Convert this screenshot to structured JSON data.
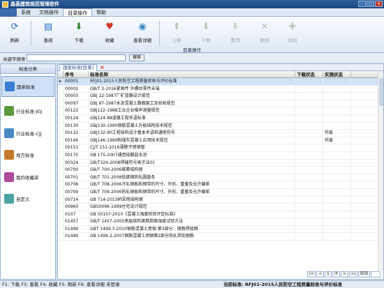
{
  "app": {
    "title": "晶荟建筑规范管理软件"
  },
  "menu": {
    "items": [
      "系统",
      "文档操作",
      "目录操作",
      "帮助"
    ],
    "active_index": 2
  },
  "ribbon": {
    "buttons": [
      {
        "label": "刷新",
        "icon": "refresh-icon",
        "enabled": true
      },
      {
        "label": "查阅",
        "icon": "document-view-icon",
        "enabled": true
      },
      {
        "label": "下载",
        "icon": "download-icon",
        "enabled": true
      },
      {
        "label": "收藏",
        "icon": "heart-icon",
        "enabled": true
      },
      {
        "label": "查看详细",
        "icon": "details-icon",
        "enabled": true
      },
      {
        "label": "上移",
        "icon": "arrow-up-icon",
        "enabled": false
      },
      {
        "label": "下移",
        "icon": "arrow-down-icon",
        "enabled": false
      },
      {
        "label": "置顶",
        "icon": "arrow-top-icon",
        "enabled": false
      },
      {
        "label": "移除",
        "icon": "remove-icon",
        "enabled": false
      },
      {
        "label": "添加",
        "icon": "add-icon",
        "enabled": false
      }
    ],
    "group_label": "目录操作"
  },
  "search": {
    "label": "关键字搜索",
    "value": "",
    "button": "搜索"
  },
  "sidebar": {
    "header": "标准分类",
    "items": [
      {
        "label": "国家标准",
        "active": true,
        "color": "#3b7fd4"
      },
      {
        "label": "行业标准-JGJ",
        "active": false,
        "color": "#5a9a3a"
      },
      {
        "label": "行业标准-CJJ",
        "active": false,
        "color": "#4a8ac4"
      },
      {
        "label": "地方标准",
        "active": false,
        "color": "#c47a2a"
      },
      {
        "label": "我的收藏夹",
        "active": false,
        "color": "#b04a9a"
      },
      {
        "label": "自定义",
        "active": false,
        "color": "#4aa4a4"
      }
    ]
  },
  "tab": {
    "label": "国家标准[目录]"
  },
  "grid": {
    "headers": [
      "序号",
      "标准名称",
      "下载状态",
      "实施状态"
    ],
    "rows": [
      {
        "no": "00001",
        "name": "RFJ01-2015人民防空工程质量验收与评价标准",
        "dl": "",
        "st": "",
        "sel": true
      },
      {
        "no": "00002",
        "name": "GB/T 2-2016紧固件 外螺纹零件末端",
        "dl": "",
        "st": ""
      },
      {
        "no": "00003",
        "name": "GBJ 22-1987厂矿道路设计规范",
        "dl": "",
        "st": ""
      },
      {
        "no": "00097",
        "name": "GBJ 97-1987水泥混凝土路面施工及验收规范",
        "dl": "",
        "st": ""
      },
      {
        "no": "00122",
        "name": "GBJ122-1988工业企业噪声测量规范",
        "dl": "",
        "st": ""
      },
      {
        "no": "00124",
        "name": "GBJ124-88道路工程术语标准",
        "dl": "",
        "st": ""
      },
      {
        "no": "00130",
        "name": "GBJ130-1990钢筋混凝土升板结构技术规范",
        "dl": "",
        "st": ""
      },
      {
        "no": "00132",
        "name": "GBJ132-90工程结构设计基本术语和通用符号",
        "dl": "",
        "st": "作废"
      },
      {
        "no": "00146",
        "name": "GBJ146-1990粉煤灰混凝土应用技术规范",
        "dl": "",
        "st": "作废"
      },
      {
        "no": "00151",
        "name": "CJ/T 151-2016薄壁不锈钢管",
        "dl": "",
        "st": ""
      },
      {
        "no": "00175",
        "name": "GB 175-2007通用硅酸盐水泥",
        "dl": "",
        "st": ""
      },
      {
        "no": "00324",
        "name": "GB/T324-2008焊缝符号表示法01",
        "dl": "",
        "st": ""
      },
      {
        "no": "00700",
        "name": "GB/T 700-2006碳素结构钢",
        "dl": "",
        "st": ""
      },
      {
        "no": "00701",
        "name": "GB/T 701-2008低碳钢热轧圆盘条",
        "dl": "",
        "st": ""
      },
      {
        "no": "00708",
        "name": "GB/T 708-2006冷轧钢板和钢带的尺寸、外形、重量及允许偏差",
        "dl": "",
        "st": ""
      },
      {
        "no": "00709",
        "name": "GB/T 709-2006热轧钢板和钢带的尺寸、外形、重量及允许偏差",
        "dl": "",
        "st": ""
      },
      {
        "no": "00714",
        "name": "GB 714-2015桥梁用结构钢",
        "dl": "",
        "st": ""
      },
      {
        "no": "00960",
        "name": "GB50096-1999住宅设计规范",
        "dl": "",
        "st": ""
      },
      {
        "no": "0107",
        "name": "GB 50107-2010《混凝土强度检验评定标准》",
        "dl": "",
        "st": ""
      },
      {
        "no": "01457",
        "name": "GB/T 1457-2005夹层结构滚筒剥离强度试验方法",
        "dl": "",
        "st": ""
      },
      {
        "no": "01499",
        "name": "GBT 1499.3-2010钢筋混凝土用钢 第3部分：钢筋焊接网",
        "dl": "",
        "st": ""
      },
      {
        "no": "01499",
        "name": "GB 1499.2-2007钢筋混凝土用钢第2部分热轧带肋钢筋",
        "dl": "",
        "st": ""
      }
    ]
  },
  "pager": {
    "first": "|<",
    "prev": "<",
    "page": "1",
    "total": "/7",
    "next": ">",
    "last": ">|",
    "goto": "转到",
    "page_input": ""
  },
  "status": {
    "left": "F1: 下载 F3: 查看 F4: 收藏 F5: 刷新 F6: 查看详细  未登录",
    "right": "当前标准: RFJ01-2015人民防空工程质量验收与评价标准"
  }
}
